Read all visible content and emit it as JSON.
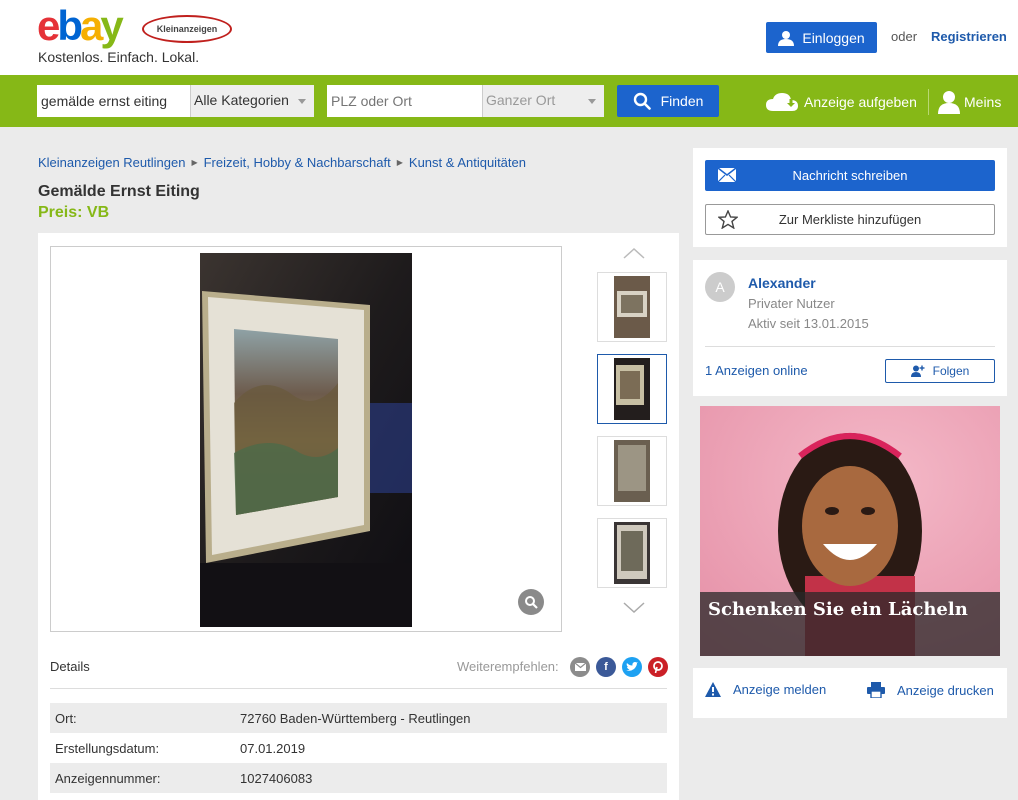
{
  "header": {
    "logo_e": "e",
    "logo_b": "b",
    "logo_a": "a",
    "logo_y": "y",
    "logo_badge": "Kleinanzeigen",
    "tagline": "Kostenlos. Einfach. Lokal.",
    "login_label": "Einloggen",
    "or_text": "oder",
    "register_label": "Registrieren"
  },
  "search": {
    "query": "gemälde ernst eiting",
    "category": "Alle Kategorien",
    "location_placeholder": "PLZ oder Ort",
    "radius": "Ganzer Ort",
    "find_label": "Finden",
    "post_ad_label": "Anzeige aufgeben",
    "account_label": "Meins"
  },
  "breadcrumb": [
    "Kleinanzeigen Reutlingen",
    "Freizeit, Hobby & Nachbarschaft",
    "Kunst & Antiquitäten"
  ],
  "listing": {
    "title": "Gemälde Ernst Eiting",
    "price": "Preis: VB",
    "details_label": "Details",
    "share_label": "Weiterempfehlen:",
    "details": [
      {
        "key": "Ort:",
        "value": "72760 Baden-Württemberg - Reutlingen"
      },
      {
        "key": "Erstellungsdatum:",
        "value": "07.01.2019"
      },
      {
        "key": "Anzeigennummer:",
        "value": "1027406083"
      }
    ]
  },
  "actions": {
    "message_label": "Nachricht schreiben",
    "watchlist_label": "Zur Merkliste hinzufügen"
  },
  "seller": {
    "initial": "A",
    "name": "Alexander",
    "type": "Privater Nutzer",
    "since": "Aktiv seit 13.01.2015",
    "ads_online": "1 Anzeigen online",
    "follow_label": "Folgen"
  },
  "ad": {
    "caption": "Schenken Sie ein Lächeln"
  },
  "footer_links": {
    "report_label": "Anzeige melden",
    "print_label": "Anzeige drucken"
  },
  "colors": {
    "brand_green": "#86b817",
    "button_blue": "#1c64cd",
    "link_blue": "#1e5aab"
  }
}
